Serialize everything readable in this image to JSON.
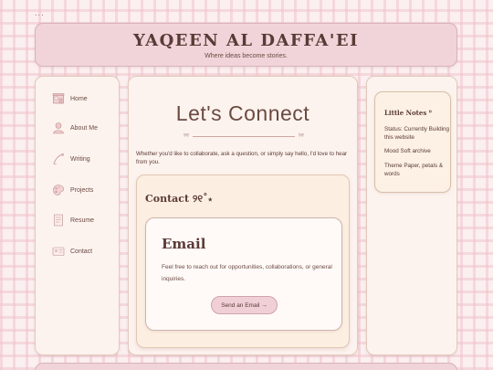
{
  "header": {
    "title": "YAQEEN AL DAFFA'EI",
    "subtitle": "Where ideas become stories."
  },
  "sidebar": {
    "items": [
      {
        "label": "Home",
        "icon": "home-icon"
      },
      {
        "label": "About Me",
        "icon": "user-icon"
      },
      {
        "label": "Writing",
        "icon": "pen-icon"
      },
      {
        "label": "Projects",
        "icon": "palette-icon"
      },
      {
        "label": "Resume",
        "icon": "document-icon"
      },
      {
        "label": "Contact",
        "icon": "id-card-icon"
      }
    ]
  },
  "main": {
    "title": "Let's Connect",
    "divider_glyph": "୨୧",
    "intro": "Whether you'd like to collaborate, ask a question, or simply say hello, I'd love to hear from you.",
    "contact": {
      "heading": "Contact ୨୧˚⋆",
      "email": {
        "title": "Email",
        "description": "Feel free to reach out for opportunities, collaborations, or general inquiries.",
        "button_label": "Send an Email →"
      }
    }
  },
  "notes": {
    "title": "Little Notes ⁰",
    "items": [
      "Status: Currently Building this website",
      "Mood Soft archive",
      "Theme Paper, petals & words"
    ]
  },
  "window": {
    "menu_dots": "..."
  },
  "colors": {
    "accent": "#f0d4d9",
    "panel": "#fdf3ee",
    "text": "#5a3a36"
  }
}
